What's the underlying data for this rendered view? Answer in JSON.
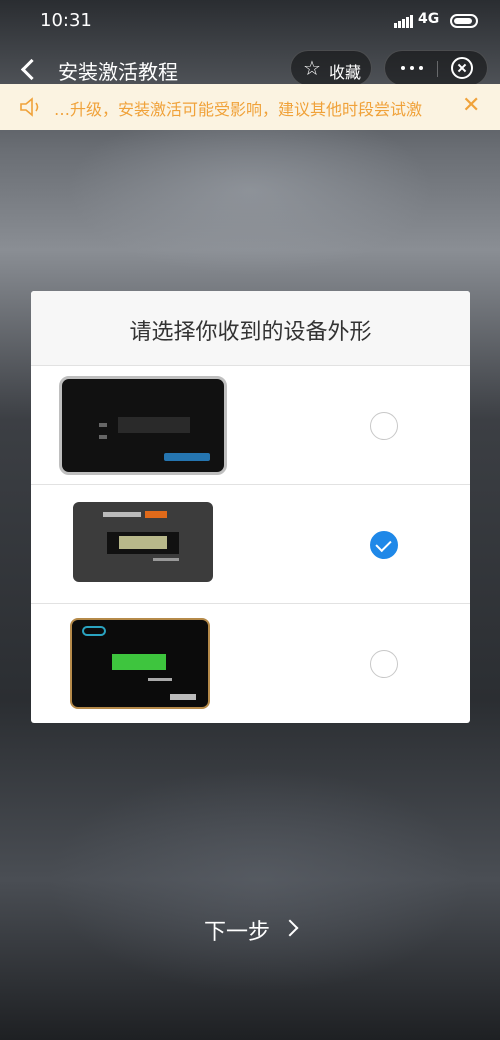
{
  "status_bar": {
    "time": "10:31",
    "network": "4G"
  },
  "nav": {
    "title": "安装激活教程",
    "favorite_label": "收藏",
    "favorite_icon": "star-icon"
  },
  "notice": {
    "text": "…升级，安装激活可能受影响，建议其他时段尝试激"
  },
  "dialog": {
    "title": "请选择你收到的设备外形",
    "options": [
      {
        "device": "device-type-1",
        "selected": false
      },
      {
        "device": "device-type-2",
        "selected": true
      },
      {
        "device": "device-type-3",
        "selected": false
      }
    ]
  },
  "next_button": {
    "label": "下一步"
  },
  "colors": {
    "accent": "#1f88e8",
    "notice_text": "#f0a23a",
    "notice_bg": "#fbf3e1"
  }
}
